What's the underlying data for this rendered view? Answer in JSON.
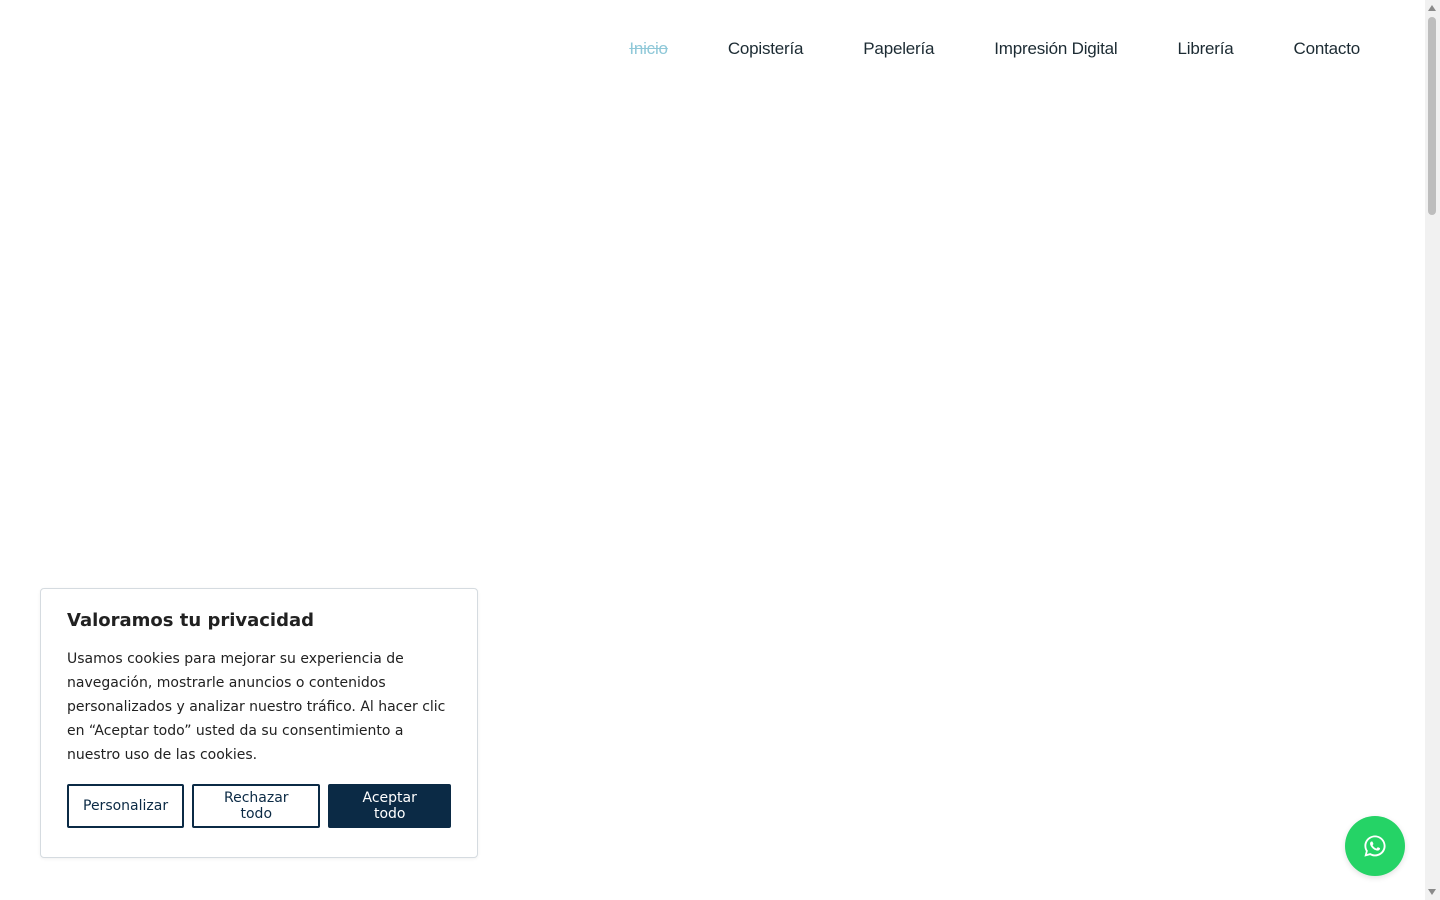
{
  "nav": {
    "items": [
      {
        "label": "Inicio",
        "active": true
      },
      {
        "label": "Copistería",
        "active": false
      },
      {
        "label": "Papelería",
        "active": false
      },
      {
        "label": "Impresión Digital",
        "active": false
      },
      {
        "label": "Librería",
        "active": false
      },
      {
        "label": "Contacto",
        "active": false
      }
    ]
  },
  "cookie": {
    "title": "Valoramos tu privacidad",
    "text": "Usamos cookies para mejorar su experiencia de navegación, mostrarle anuncios o contenidos personalizados y analizar nuestro tráfico. Al hacer clic en “Aceptar todo” usted da su consentimiento a nuestro uso de las cookies.",
    "customize_label": "Personalizar",
    "reject_label": "Rechazar todo",
    "accept_label": "Aceptar todo"
  },
  "whatsapp": {
    "icon": "whatsapp-icon"
  },
  "colors": {
    "accent": "#0b2a45",
    "active_link": "#8fc8d8",
    "whatsapp": "#25d366"
  }
}
